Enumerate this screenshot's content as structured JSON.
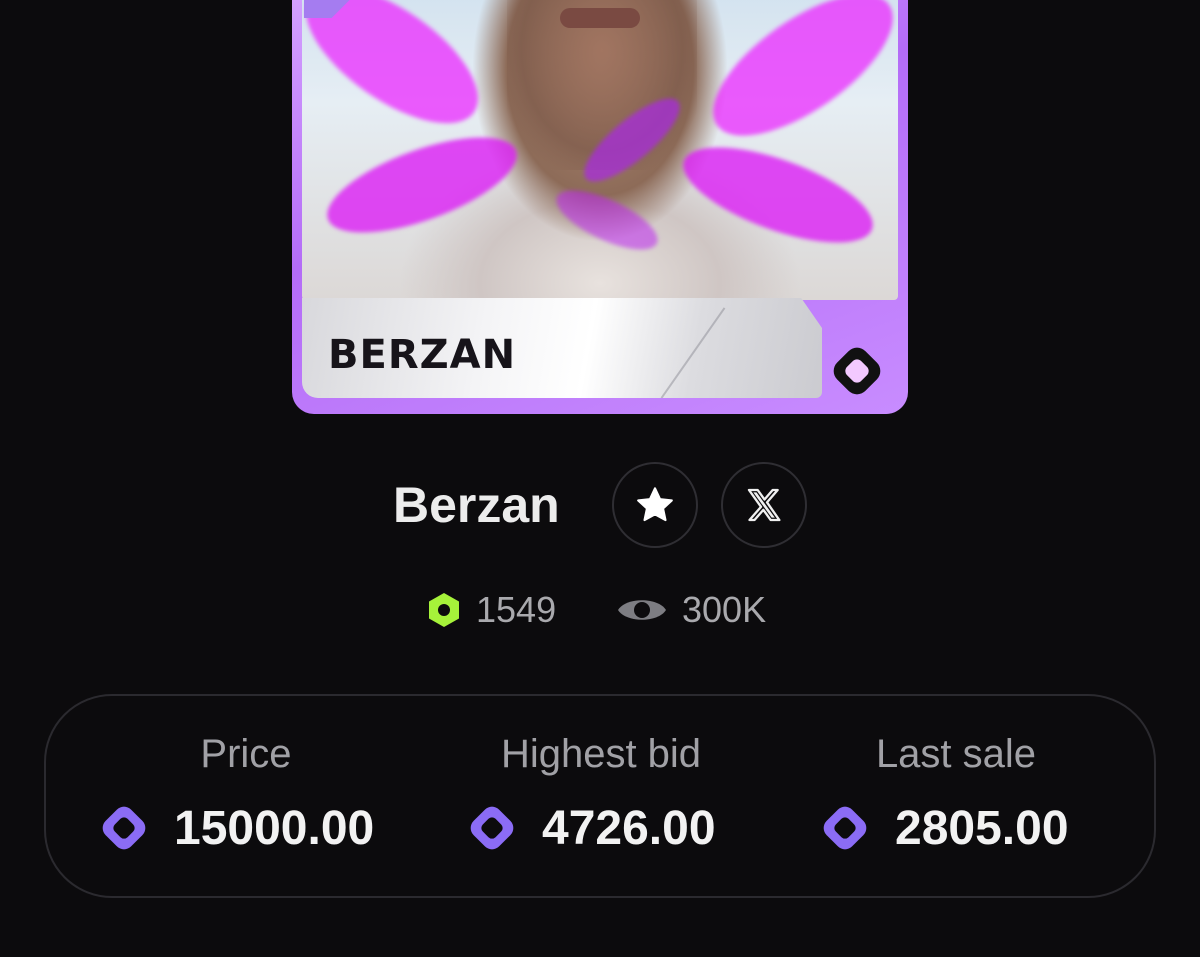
{
  "card": {
    "nameplate": "BERZAN",
    "art_icon": "player-portrait",
    "badge_icon": "rounded-diamond-icon",
    "corner_icon": "star-icon"
  },
  "player": {
    "name": "Berzan",
    "favorite_icon": "star-icon",
    "social_icon": "x-logo-icon"
  },
  "stats": {
    "score": "1549",
    "score_icon": "hexagon-icon",
    "score_color": "#a6f23a",
    "views": "300K",
    "views_icon": "eye-icon"
  },
  "prices": {
    "price_label": "Price",
    "price_value": "15000.00",
    "highest_bid_label": "Highest bid",
    "highest_bid_value": "4726.00",
    "last_sale_label": "Last sale",
    "last_sale_value": "2805.00",
    "currency_icon": "rounded-diamond-icon",
    "currency_color": "#8b6cf5"
  },
  "colors": {
    "background": "#0c0b0d",
    "card_accent": "#b46cf7"
  }
}
